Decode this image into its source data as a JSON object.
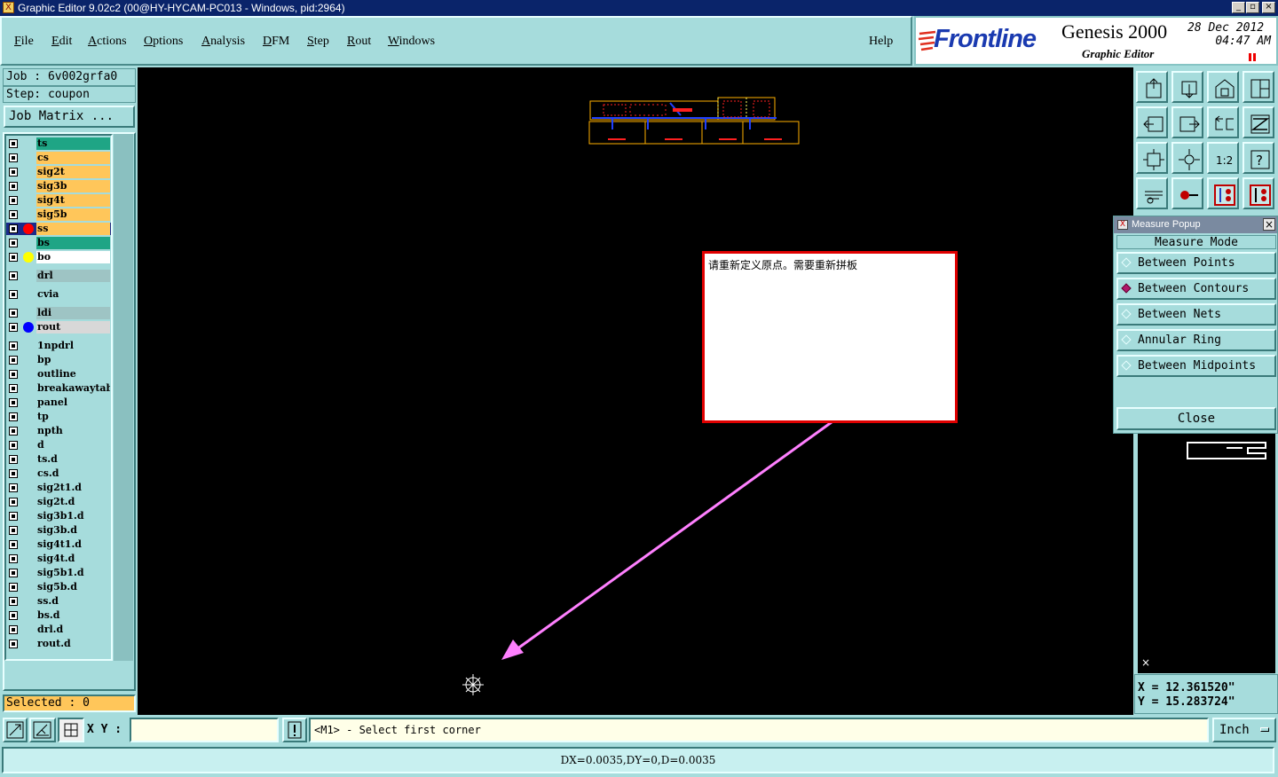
{
  "window": {
    "title": "Graphic Editor 9.02c2 (00@HY-HYCAM-PC013 - Windows, pid:2964)",
    "minimize_glyph": "_",
    "maximize_glyph": "▫",
    "close_glyph": "×"
  },
  "menu": {
    "items": [
      {
        "first": "F",
        "rest": "ile"
      },
      {
        "first": "E",
        "rest": "dit"
      },
      {
        "first": "A",
        "rest": "ctions"
      },
      {
        "first": "O",
        "rest": "ptions"
      },
      {
        "first": "A",
        "rest": "nalysis"
      },
      {
        "first": "D",
        "rest": "FM"
      },
      {
        "first": "S",
        "rest": "tep"
      },
      {
        "first": "R",
        "rest": "out"
      },
      {
        "first": "W",
        "rest": "indows"
      }
    ],
    "help": "Help"
  },
  "logo": {
    "brand": "Frontline",
    "product": "Genesis 2000",
    "subtitle": "Graphic Editor",
    "date": "28 Dec 2012",
    "time": "04:47 AM"
  },
  "job": {
    "job_label": "Job  : 6v002grfa0",
    "step_label": "Step: coupon",
    "matrix_button": "Job Matrix ..."
  },
  "layers": [
    {
      "name": "ts",
      "color": "#1fa585",
      "dot": ""
    },
    {
      "name": "cs",
      "color": "#ffc65a",
      "dot": ""
    },
    {
      "name": "sig2t",
      "color": "#ffc65a",
      "dot": ""
    },
    {
      "name": "sig3b",
      "color": "#ffc65a",
      "dot": ""
    },
    {
      "name": "sig4t",
      "color": "#ffc65a",
      "dot": ""
    },
    {
      "name": "sig5b",
      "color": "#ffc65a",
      "dot": ""
    },
    {
      "name": "ss",
      "color": "#ffc65a",
      "dot": "#ff0000",
      "affected": true
    },
    {
      "name": "bs",
      "color": "#1fa585",
      "dot": ""
    },
    {
      "name": "bo",
      "color": "#ffffff",
      "dot": "#ffff00"
    },
    {
      "name": "drl",
      "color": "#9ec4c4",
      "dot": ""
    },
    {
      "name": "cvia",
      "color": "#a6dcdc",
      "dot": ""
    },
    {
      "name": "ldi",
      "color": "#9ec4c4",
      "dot": ""
    },
    {
      "name": "rout",
      "color": "#d8d8d8",
      "dot": "#0000ff"
    },
    {
      "name": "1npdrl",
      "color": "#a6dcdc",
      "dot": ""
    },
    {
      "name": "bp",
      "color": "#a6dcdc",
      "dot": ""
    },
    {
      "name": "outline",
      "color": "#a6dcdc",
      "dot": ""
    },
    {
      "name": "breakawaytab",
      "color": "#a6dcdc",
      "dot": ""
    },
    {
      "name": "panel",
      "color": "#a6dcdc",
      "dot": ""
    },
    {
      "name": "tp",
      "color": "#a6dcdc",
      "dot": ""
    },
    {
      "name": "npth",
      "color": "#a6dcdc",
      "dot": ""
    },
    {
      "name": "d",
      "color": "#a6dcdc",
      "dot": ""
    },
    {
      "name": "ts.d",
      "color": "#a6dcdc",
      "dot": ""
    },
    {
      "name": "cs.d",
      "color": "#a6dcdc",
      "dot": ""
    },
    {
      "name": "sig2t1.d",
      "color": "#a6dcdc",
      "dot": ""
    },
    {
      "name": "sig2t.d",
      "color": "#a6dcdc",
      "dot": ""
    },
    {
      "name": "sig3b1.d",
      "color": "#a6dcdc",
      "dot": ""
    },
    {
      "name": "sig3b.d",
      "color": "#a6dcdc",
      "dot": ""
    },
    {
      "name": "sig4t1.d",
      "color": "#a6dcdc",
      "dot": ""
    },
    {
      "name": "sig4t.d",
      "color": "#a6dcdc",
      "dot": ""
    },
    {
      "name": "sig5b1.d",
      "color": "#a6dcdc",
      "dot": ""
    },
    {
      "name": "sig5b.d",
      "color": "#a6dcdc",
      "dot": ""
    },
    {
      "name": "ss.d",
      "color": "#a6dcdc",
      "dot": ""
    },
    {
      "name": "bs.d",
      "color": "#a6dcdc",
      "dot": ""
    },
    {
      "name": "drl.d",
      "color": "#a6dcdc",
      "dot": ""
    },
    {
      "name": "rout.d",
      "color": "#a6dcdc",
      "dot": ""
    }
  ],
  "selected_label": "Selected : 0",
  "annotation": {
    "text": "请重新定义原点。需要重新拼板"
  },
  "measure_popup": {
    "title": "Measure Popup",
    "mode_label": "Measure Mode",
    "options": [
      {
        "label": "Between Points",
        "selected": false
      },
      {
        "label": "Between Contours",
        "selected": true
      },
      {
        "label": "Between Nets",
        "selected": false
      },
      {
        "label": "Annular Ring",
        "selected": false
      },
      {
        "label": "Between Midpoints",
        "selected": false
      }
    ],
    "close_label": "Close"
  },
  "toolbar_icons": [
    "zoom-home-icon",
    "zoom-back-icon",
    "home-view-icon",
    "split-view-icon",
    "zoom-left-icon",
    "zoom-right-icon",
    "pan-swap-icon",
    "snap-icon",
    "fit-screen-icon",
    "center-icon",
    "scale-1-2-icon",
    "help-query-icon",
    "measure-tool-icon",
    "route-tool-icon",
    "net-highlight-icon",
    "net-compare-icon"
  ],
  "coords": {
    "x": "X = 12.361520\"",
    "y": "Y = 15.283724\""
  },
  "bottom": {
    "xy_label": "X Y :",
    "xy_value": "",
    "prompt": "<M1> - Select first corner",
    "units": "Inch",
    "status": "DX=0.0035,DY=0,D=0.0035"
  }
}
